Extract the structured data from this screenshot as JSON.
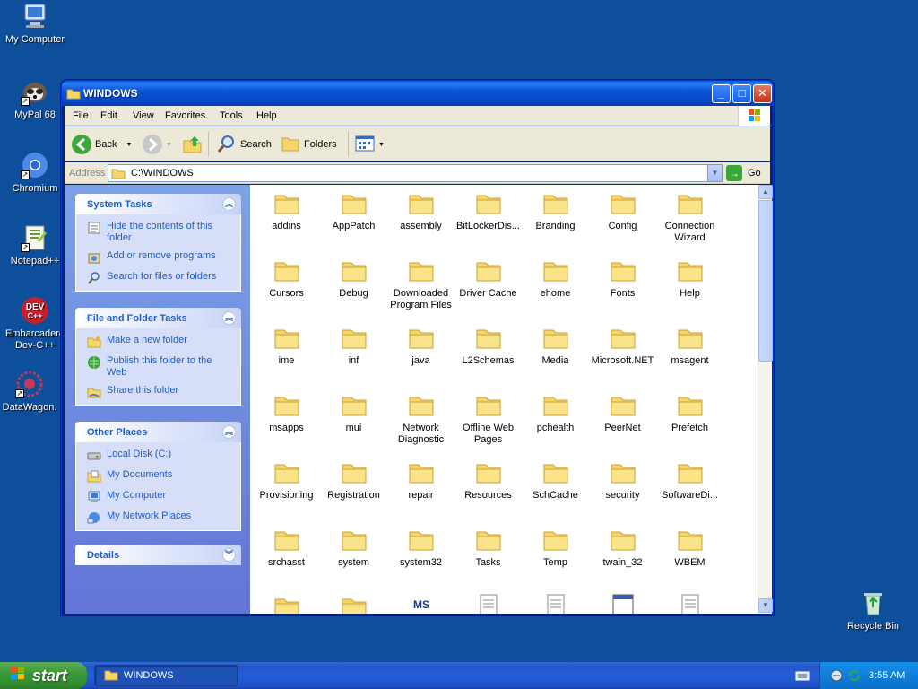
{
  "desktop": {
    "icons": [
      {
        "label": "My Computer"
      },
      {
        "label": "MyPal 68"
      },
      {
        "label": "Chromium"
      },
      {
        "label": "Notepad++"
      },
      {
        "label": "Embarcadero Dev-C++"
      },
      {
        "label": "DataWagon."
      },
      {
        "label": "Recycle Bin"
      }
    ]
  },
  "window": {
    "title": "WINDOWS",
    "menu": [
      "File",
      "Edit",
      "View",
      "Favorites",
      "Tools",
      "Help"
    ],
    "toolbar": {
      "back": "Back",
      "search": "Search",
      "folders": "Folders"
    },
    "address": {
      "label": "Address",
      "value": "C:\\WINDOWS",
      "go": "Go"
    }
  },
  "taskpane": {
    "system_tasks": {
      "title": "System Tasks",
      "links": [
        "Hide the contents of this folder",
        "Add or remove programs",
        "Search for files or folders"
      ]
    },
    "file_folder_tasks": {
      "title": "File and Folder Tasks",
      "links": [
        "Make a new folder",
        "Publish this folder to the Web",
        "Share this folder"
      ]
    },
    "other_places": {
      "title": "Other Places",
      "links": [
        "Local Disk (C:)",
        "My Documents",
        "My Computer",
        "My Network Places"
      ]
    },
    "details": {
      "title": "Details"
    }
  },
  "files": [
    "addins",
    "AppPatch",
    "assembly",
    "BitLockerDis...",
    "Branding",
    "Config",
    "Connection Wizard",
    "Cursors",
    "Debug",
    "Downloaded Program Files",
    "Driver Cache",
    "ehome",
    "Fonts",
    "Help",
    "ime",
    "inf",
    "java",
    "L2Schemas",
    "Media",
    "Microsoft.NET",
    "msagent",
    "msapps",
    "mui",
    "Network Diagnostic",
    "Offline Web Pages",
    "pchealth",
    "PeerNet",
    "Prefetch",
    "Provisioning",
    "Registration",
    "repair",
    "Resources",
    "SchCache",
    "security",
    "SoftwareDi...",
    "srchasst",
    "system",
    "system32",
    "Tasks",
    "Temp",
    "twain_32",
    "WBEM"
  ],
  "taskbar": {
    "start": "start",
    "task": "WINDOWS",
    "clock": "3:55 AM"
  }
}
